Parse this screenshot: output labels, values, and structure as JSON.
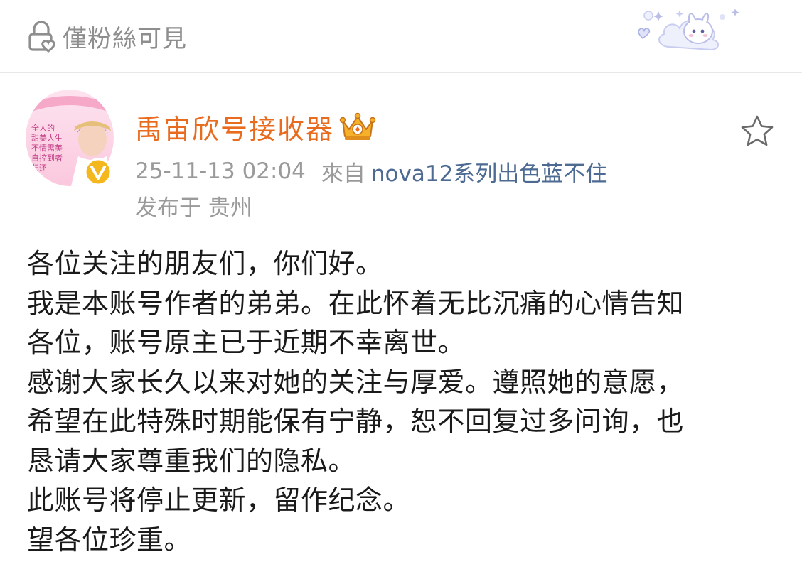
{
  "header": {
    "visibility_label": "僅粉絲可見"
  },
  "post": {
    "author": {
      "name": "禹宙欣号接收器",
      "avatar_text": [
        "全人的",
        "甜美人生",
        "不情需美",
        "自控到者",
        "归还"
      ]
    },
    "meta": {
      "time": "25-11-13 02:04",
      "from_label": "來自",
      "device": "nova12系列出色蓝不住"
    },
    "location": "发布于 贵州",
    "body_lines": [
      "各位关注的朋友们，你们好。",
      "我是本账号作者的弟弟。在此怀着无比沉痛的心情告知",
      "各位，账号原主已于近期不幸离世。",
      "感谢大家长久以来对她的关注与厚爱。遵照她的意愿，",
      "希望在此特殊时期能保有宁静，恕不回复过多问询，也",
      "恳请大家尊重我们的隐私。",
      "此账号将停止更新，留作纪念。",
      "望各位珍重。"
    ]
  },
  "colors": {
    "username": "#e86b1e",
    "meta_gray": "#9a9a9a",
    "device_link": "#4c6a92",
    "verified_gold": "#f5b71e"
  },
  "icons": {
    "visibility": "lock-heart-icon",
    "crown": "crown-icon",
    "favorite": "star-icon",
    "verified": "verified-badge-icon"
  }
}
